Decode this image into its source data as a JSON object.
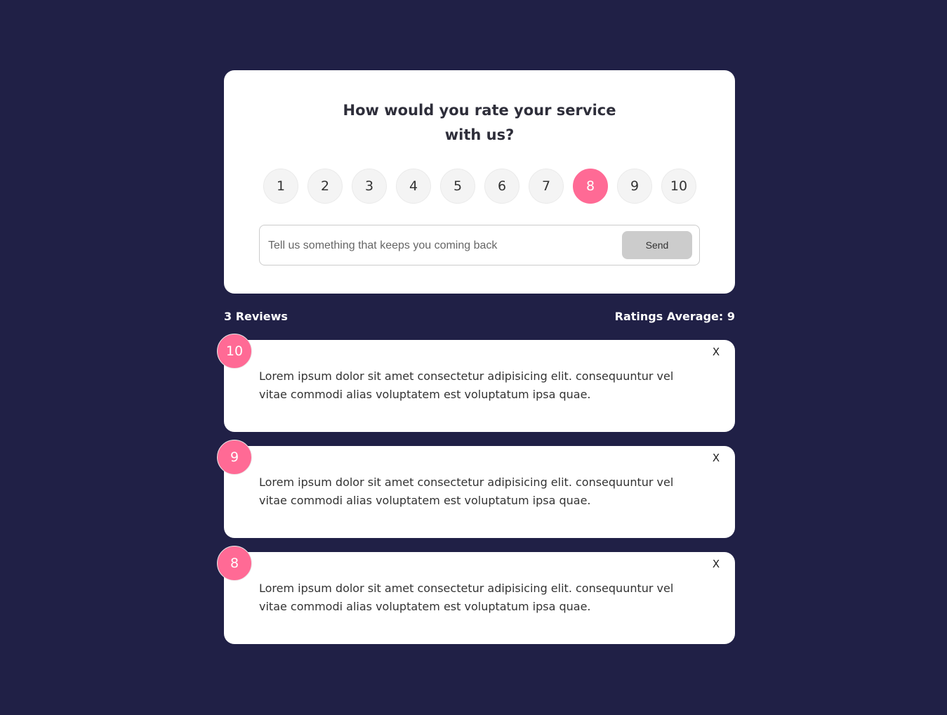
{
  "rating_card": {
    "question_line1": "How would you rate your service",
    "question_line2": "with us?",
    "options": [
      "1",
      "2",
      "3",
      "4",
      "5",
      "6",
      "7",
      "8",
      "9",
      "10"
    ],
    "selected": "8",
    "input_placeholder": "Tell us something that keeps you coming back",
    "send_label": "Send"
  },
  "stats": {
    "count_label": "3 Reviews",
    "average_label": "Ratings Average: 9"
  },
  "reviews": [
    {
      "rating": "10",
      "text": "Lorem ipsum dolor sit amet consectetur adipisicing elit. consequuntur vel vitae commodi alias voluptatem est voluptatum ipsa quae.",
      "close": "X"
    },
    {
      "rating": "9",
      "text": "Lorem ipsum dolor sit amet consectetur adipisicing elit. consequuntur vel vitae commodi alias voluptatem est voluptatum ipsa quae.",
      "close": "X"
    },
    {
      "rating": "8",
      "text": "Lorem ipsum dolor sit amet consectetur adipisicing elit. consequuntur vel vitae commodi alias voluptatem est voluptatum ipsa quae.",
      "close": "X"
    }
  ],
  "colors": {
    "background": "#202046",
    "accent": "#ff6a95",
    "button": "#cccccc"
  }
}
